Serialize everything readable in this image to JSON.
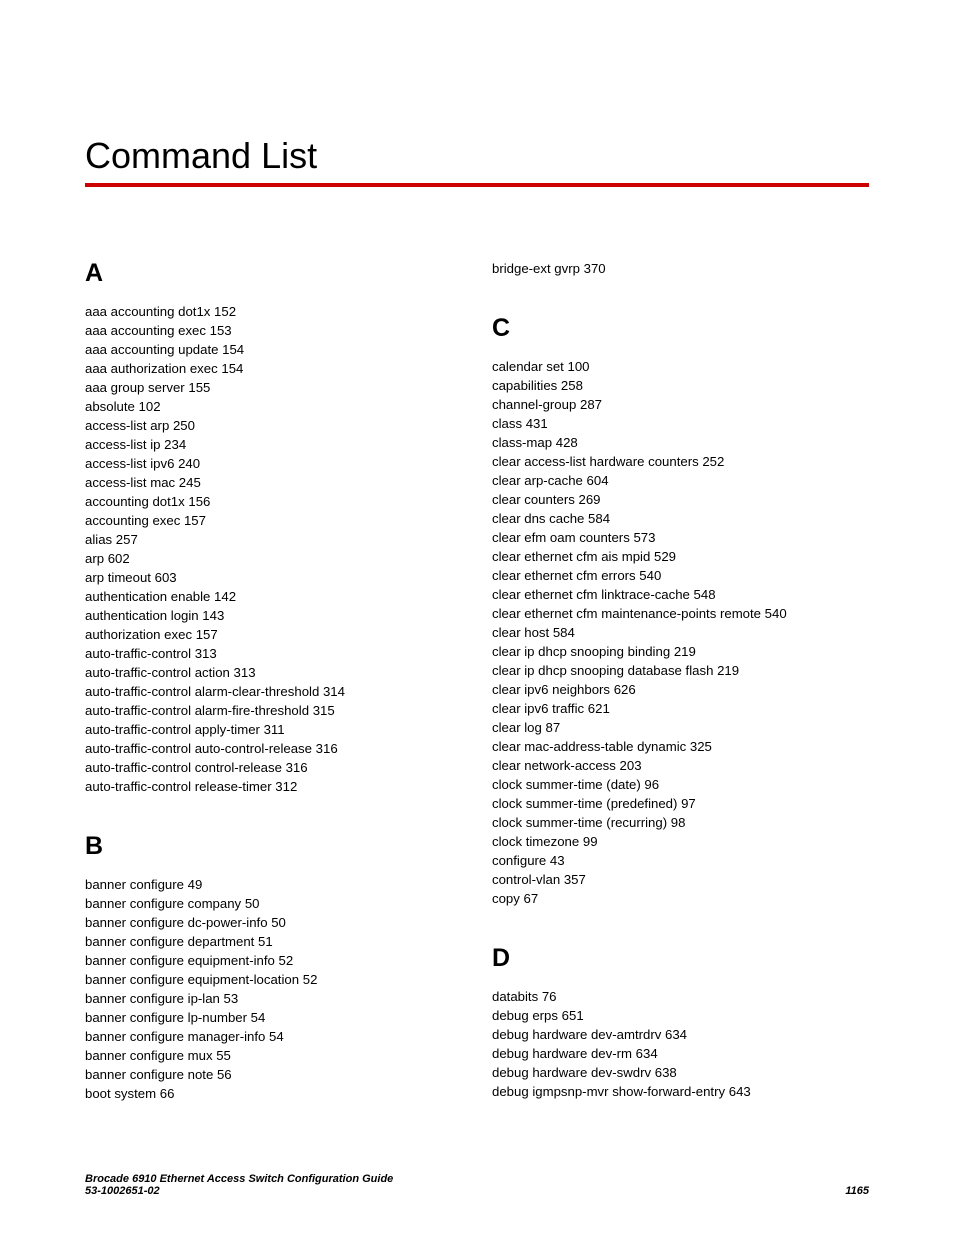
{
  "title": "Command List",
  "footer": {
    "line1": "Brocade 6910 Ethernet Access Switch Configuration Guide",
    "line2": "53-1002651-02",
    "pagenum": "1165"
  },
  "left": {
    "sections": [
      {
        "head": "A",
        "entries": [
          "aaa accounting dot1x 152",
          "aaa accounting exec 153",
          "aaa accounting update 154",
          "aaa authorization exec 154",
          "aaa group server 155",
          "absolute 102",
          "access-list arp 250",
          "access-list ip 234",
          "access-list ipv6 240",
          "access-list mac 245",
          "accounting dot1x 156",
          "accounting exec 157",
          "alias 257",
          "arp 602",
          "arp timeout 603",
          "authentication enable 142",
          "authentication login 143",
          "authorization exec 157",
          "auto-traffic-control 313",
          "auto-traffic-control action 313",
          "auto-traffic-control alarm-clear-threshold 314",
          "auto-traffic-control alarm-fire-threshold 315",
          "auto-traffic-control apply-timer 311",
          "auto-traffic-control auto-control-release 316",
          "auto-traffic-control control-release 316",
          "auto-traffic-control release-timer 312"
        ]
      },
      {
        "head": "B",
        "entries": [
          "banner configure 49",
          "banner configure company 50",
          "banner configure dc-power-info 50",
          "banner configure department 51",
          "banner configure equipment-info 52",
          "banner configure equipment-location 52",
          "banner configure ip-lan 53",
          "banner configure lp-number 54",
          "banner configure manager-info 54",
          "banner configure mux 55",
          "banner configure note 56",
          "boot system 66"
        ]
      }
    ]
  },
  "right": {
    "lead": "bridge-ext gvrp 370",
    "sections": [
      {
        "head": "C",
        "entries": [
          "calendar set 100",
          "capabilities 258",
          "channel-group  287",
          "class 431",
          "class-map 428",
          "clear access-list hardware counters 252",
          "clear arp-cache 604",
          "clear counters 269",
          "clear dns cache 584",
          "clear efm oam counters 573",
          "clear ethernet cfm ais mpid 529",
          "clear ethernet cfm errors 540",
          "clear ethernet cfm linktrace-cache 548",
          "clear ethernet cfm maintenance-points remote 540",
          "clear host 584",
          "clear ip dhcp snooping binding 219",
          "clear ip dhcp snooping database flash 219",
          "clear ipv6 neighbors 626",
          "clear ipv6 traffic 621",
          "clear log 87",
          "clear mac-address-table dynamic 325",
          "clear network-access 203",
          "clock summer-time (date) 96",
          "clock summer-time (predefined) 97",
          "clock summer-time (recurring) 98",
          "clock timezone 99",
          "configure 43",
          "control-vlan 357",
          "copy 67"
        ]
      },
      {
        "head": "D",
        "entries": [
          "databits 76",
          "debug erps 651",
          "debug hardware dev-amtrdrv 634",
          "debug hardware dev-rm 634",
          "debug hardware dev-swdrv 638",
          "debug igmpsnp-mvr show-forward-entry 643"
        ]
      }
    ]
  }
}
